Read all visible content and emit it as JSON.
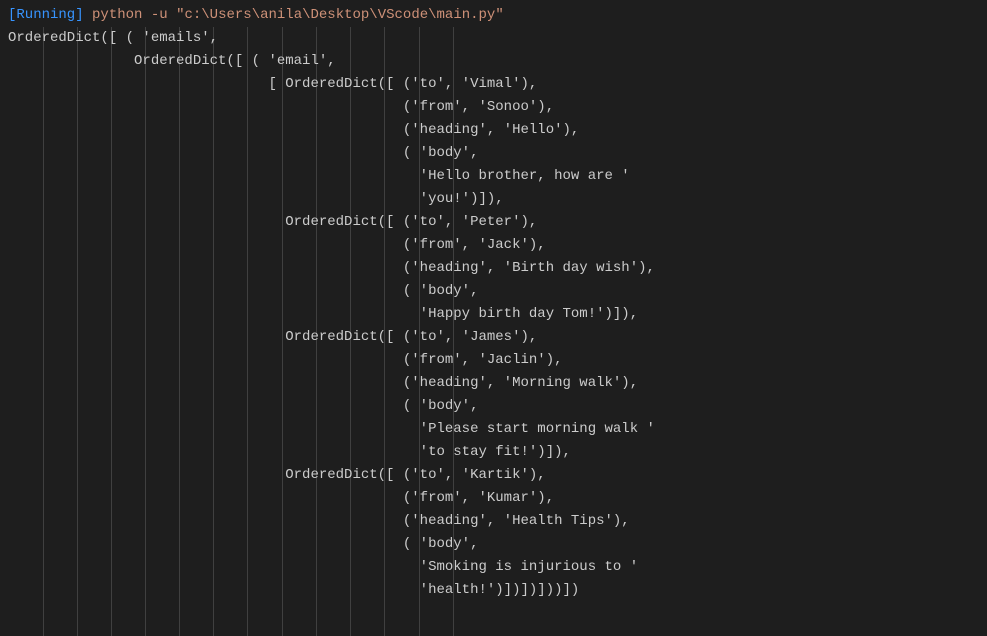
{
  "terminal": {
    "status_label": "[Running]",
    "command": "python",
    "flag": "-u",
    "script_path": "\"c:\\Users\\anila\\Desktop\\VScode\\main.py\"",
    "output_lines": [
      "OrderedDict([ ( 'emails',",
      "               OrderedDict([ ( 'email',",
      "                               [ OrderedDict([ ('to', 'Vimal'),",
      "                                               ('from', 'Sonoo'),",
      "                                               ('heading', 'Hello'),",
      "                                               ( 'body',",
      "                                                 'Hello brother, how are '",
      "                                                 'you!')]),",
      "                                 OrderedDict([ ('to', 'Peter'),",
      "                                               ('from', 'Jack'),",
      "                                               ('heading', 'Birth day wish'),",
      "                                               ( 'body',",
      "                                                 'Happy birth day Tom!')]),",
      "                                 OrderedDict([ ('to', 'James'),",
      "                                               ('from', 'Jaclin'),",
      "                                               ('heading', 'Morning walk'),",
      "                                               ( 'body',",
      "                                                 'Please start morning walk '",
      "                                                 'to stay fit!')]),",
      "                                 OrderedDict([ ('to', 'Kartik'),",
      "                                               ('from', 'Kumar'),",
      "                                               ('heading', 'Health Tips'),",
      "                                               ( 'body',",
      "                                                 'Smoking is injurious to '",
      "                                                 'health!')])])]))])"
    ]
  },
  "indent_guide_positions": [
    35,
    69,
    103,
    137,
    171,
    205,
    239,
    274,
    308,
    342,
    376,
    411,
    445
  ]
}
